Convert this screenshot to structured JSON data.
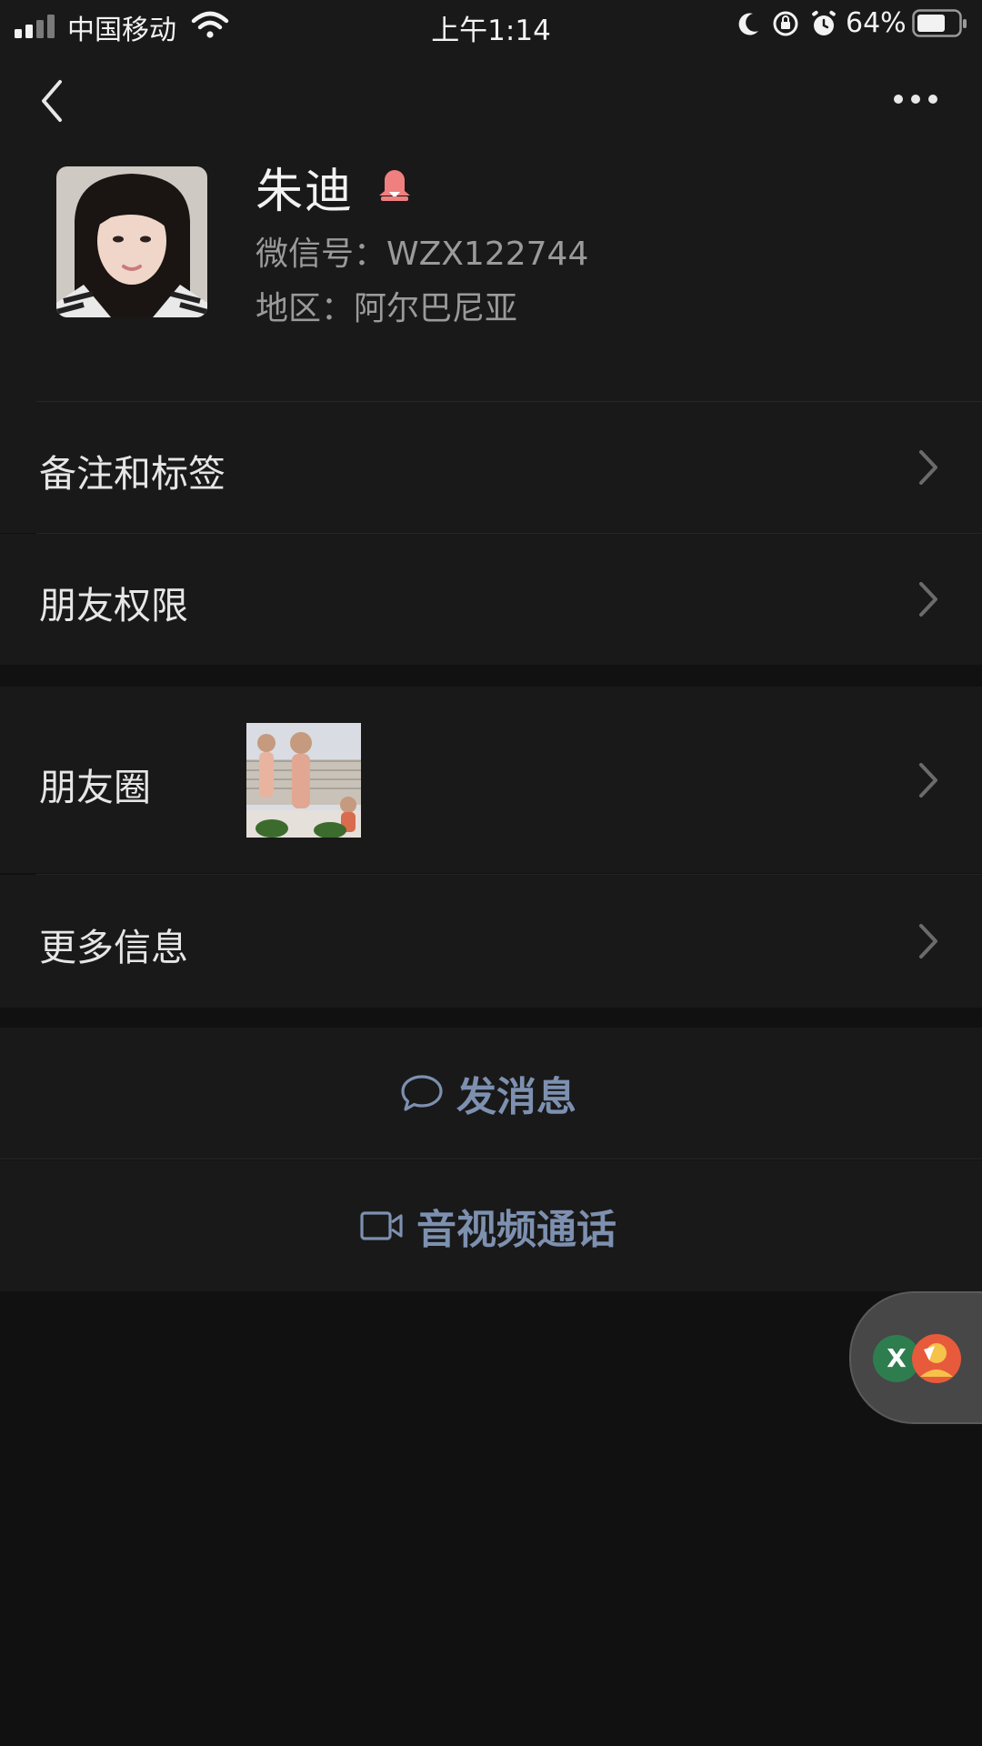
{
  "status_bar": {
    "carrier": "中国移动",
    "time": "上午1:14",
    "battery": "64%"
  },
  "nav": {
    "back_icon": "chevron-left-icon",
    "more_icon": "more-dots-icon"
  },
  "profile": {
    "name": "朱迪",
    "gender_icon": "female-icon",
    "wechat_id": "微信号：WZX122744",
    "region": "地区：阿尔巴尼亚"
  },
  "rows": {
    "remarks": "备注和标签",
    "permissions": "朋友权限",
    "moments": "朋友圈",
    "more_info": "更多信息"
  },
  "actions": {
    "message": "发消息",
    "call": "音视频通话"
  },
  "floating": {
    "badge": "X"
  },
  "colors": {
    "background": "#111111",
    "panel": "#191919",
    "action_text": "#7d90b0",
    "female_badge": "#f07f7f"
  }
}
